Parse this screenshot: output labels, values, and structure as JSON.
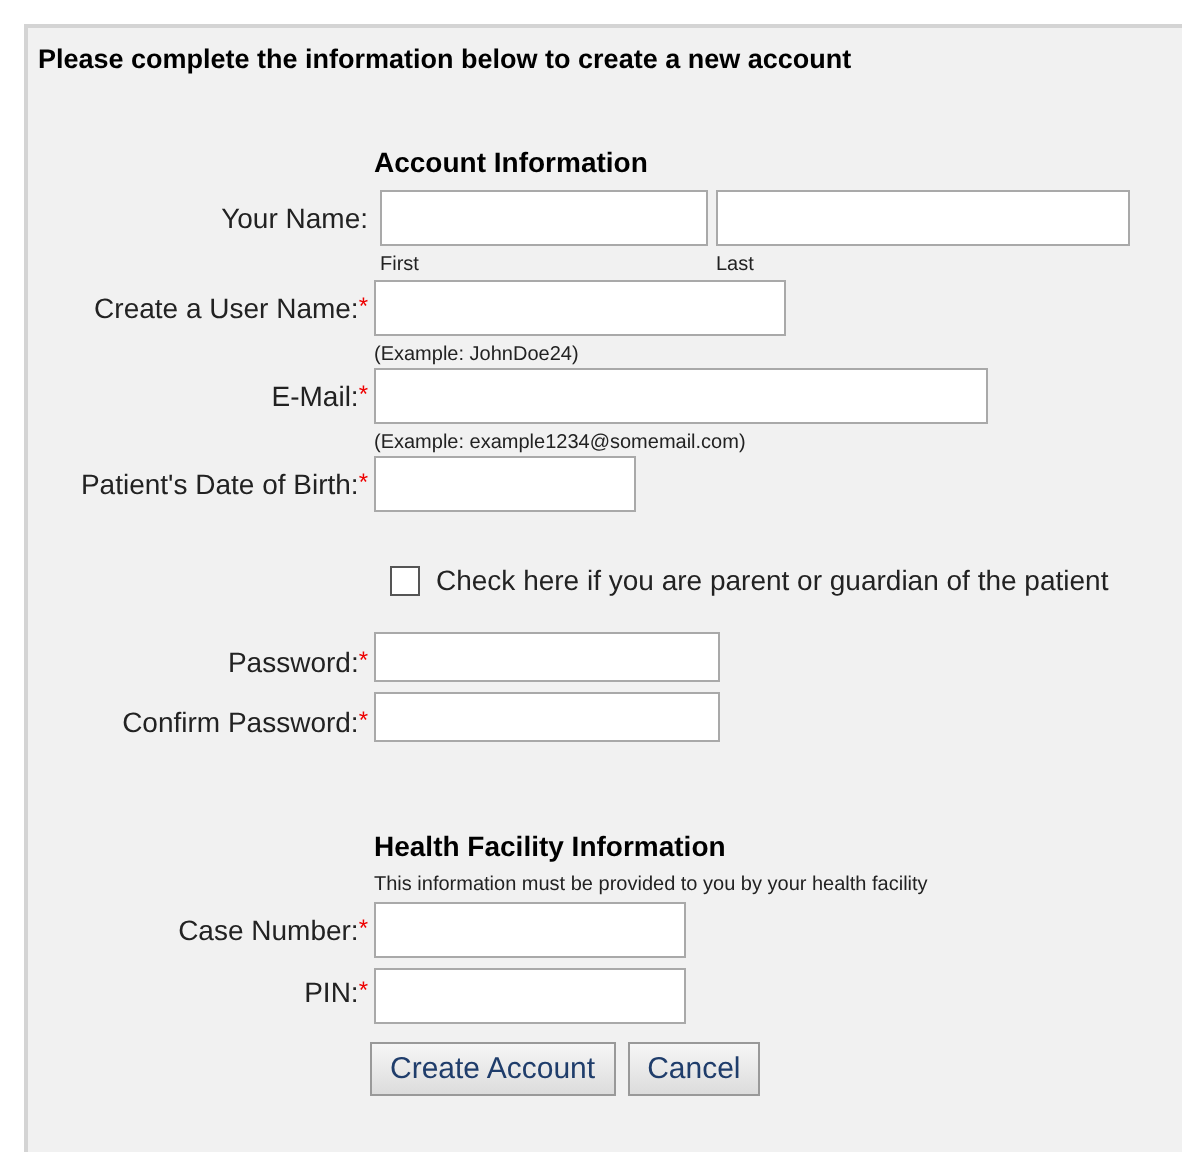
{
  "title": "Please complete the information below to create a new account",
  "sections": [
    {
      "heading": "Account Information",
      "items": [
        {
          "kind": "name",
          "label": "Your Name:",
          "sublabels": [
            "First",
            "Last"
          ]
        },
        {
          "kind": "text",
          "label": "Create a User Name:",
          "required_mark": "*",
          "hint": "(Example: JohnDoe24)"
        },
        {
          "kind": "text",
          "label": "E-Mail:",
          "required_mark": "*",
          "hint": "(Example: example1234@somemail.com)"
        },
        {
          "kind": "text",
          "label": "Patient's Date of Birth:",
          "required_mark": "*"
        },
        {
          "kind": "checkbox",
          "label": "Check here if you are parent or guardian of the patient",
          "checked": false
        },
        {
          "kind": "password",
          "label": "Password:",
          "required_mark": "*"
        },
        {
          "kind": "password",
          "label": "Confirm Password:",
          "required_mark": "*"
        }
      ]
    },
    {
      "heading": "Health Facility Information",
      "note": "This information must be provided to you by your health facility",
      "items": [
        {
          "kind": "text",
          "label": "Case Number:",
          "required_mark": "*"
        },
        {
          "kind": "text",
          "label": "PIN:",
          "required_mark": "*"
        }
      ]
    }
  ],
  "buttons": [
    "Create Account",
    "Cancel"
  ]
}
